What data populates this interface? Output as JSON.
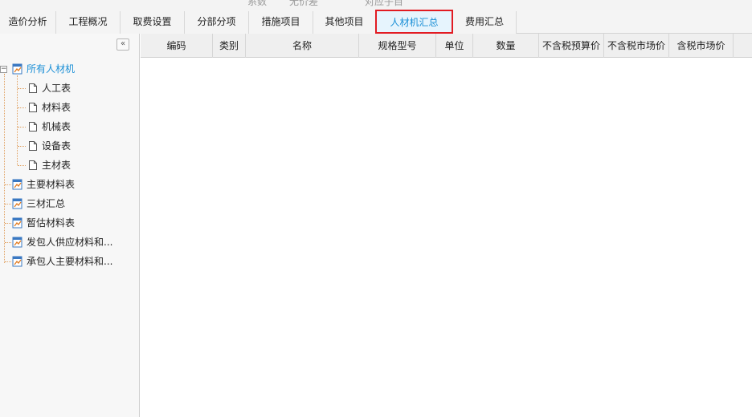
{
  "top_strip": {
    "fragments": [
      "系数",
      "无价差",
      "对应子目"
    ]
  },
  "tabs": [
    {
      "label": "造价分析",
      "active": false
    },
    {
      "label": "工程概况",
      "active": false
    },
    {
      "label": "取费设置",
      "active": false
    },
    {
      "label": "分部分项",
      "active": false
    },
    {
      "label": "措施项目",
      "active": false
    },
    {
      "label": "其他项目",
      "active": false
    },
    {
      "label": "人材机汇总",
      "active": true
    },
    {
      "label": "费用汇总",
      "active": false
    }
  ],
  "sidebar": {
    "collapse_glyph": "«",
    "expander_glyph": "−",
    "root": {
      "label": "所有人材机",
      "icon": "table-icon"
    },
    "children": [
      {
        "label": "人工表",
        "icon": "document-icon"
      },
      {
        "label": "材料表",
        "icon": "document-icon"
      },
      {
        "label": "机械表",
        "icon": "document-icon"
      },
      {
        "label": "设备表",
        "icon": "document-icon"
      },
      {
        "label": "主材表",
        "icon": "document-icon"
      }
    ],
    "groups": [
      {
        "label": "主要材料表",
        "icon": "table-icon"
      },
      {
        "label": "三材汇总",
        "icon": "table-icon"
      },
      {
        "label": "暂估材料表",
        "icon": "table-icon"
      },
      {
        "label": "发包人供应材料和...",
        "icon": "table-icon"
      },
      {
        "label": "承包人主要材料和...",
        "icon": "table-icon"
      }
    ]
  },
  "grid": {
    "columns": [
      "编码",
      "类别",
      "名称",
      "规格型号",
      "单位",
      "数量",
      "不含税预算价",
      "不含税市场价",
      "含税市场价"
    ],
    "rows": []
  },
  "colors": {
    "accent": "#1b8fd6",
    "active_tab_border": "#e21b22",
    "tree_line": "#e0a060"
  }
}
